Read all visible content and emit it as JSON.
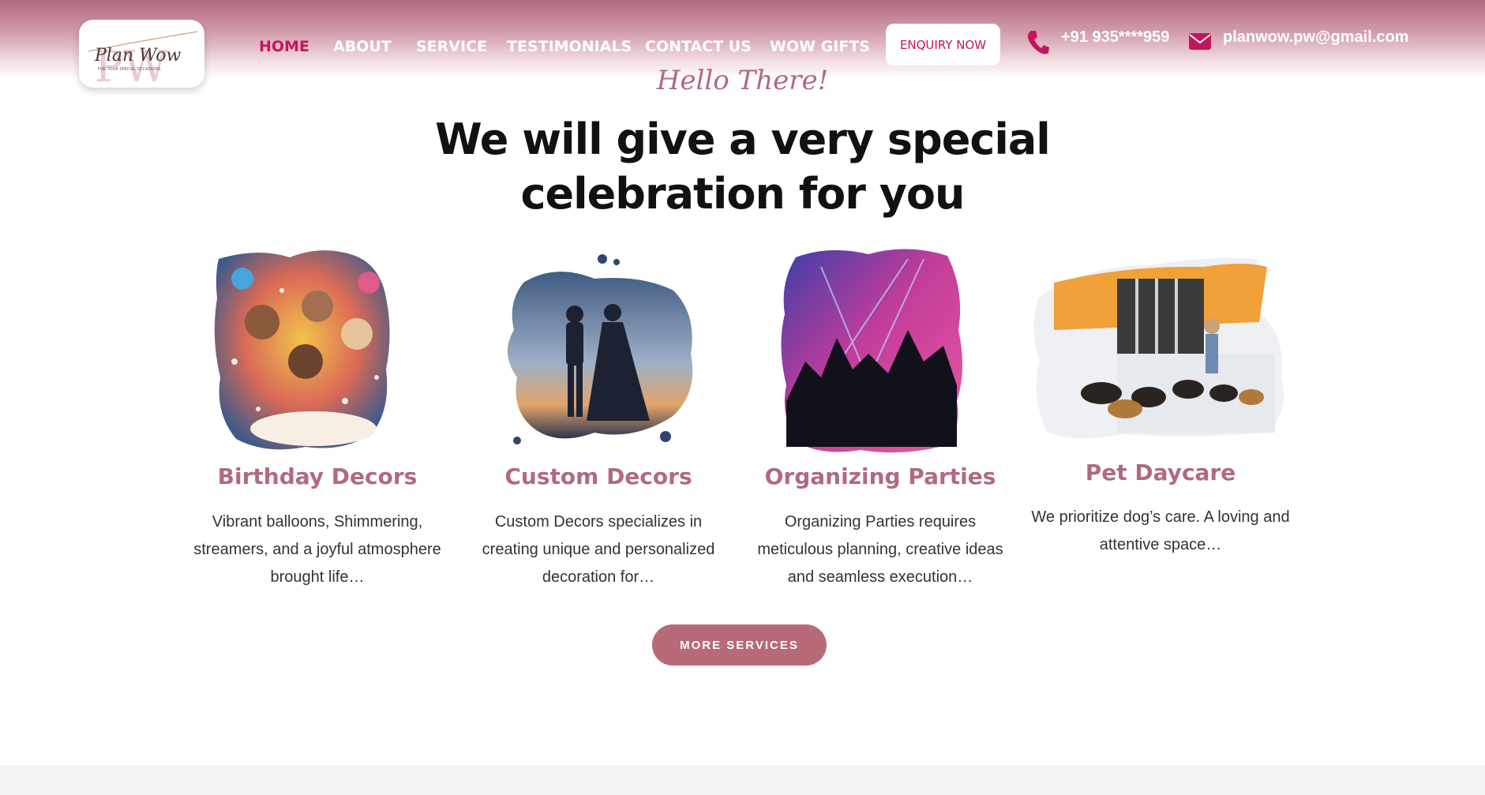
{
  "header": {
    "logo_text": "Plan Wow",
    "logo_monogram": "PW",
    "logo_tagline": "FOR YOUR SPECIAL OCCASIONS",
    "nav": [
      {
        "label": "HOME",
        "active": true
      },
      {
        "label": "ABOUT",
        "active": false
      },
      {
        "label": "SERVICE",
        "active": false
      },
      {
        "label": "TESTIMONIALS",
        "active": false
      },
      {
        "label": "CONTACT US",
        "active": false
      },
      {
        "label": "WOW GIFTS",
        "active": false
      }
    ],
    "enquiry_label": "ENQUIRY NOW",
    "phone": "+91 935****959",
    "email": "planwow.pw@gmail.com"
  },
  "hero": {
    "greeting": "Hello There!",
    "headline_line1": "We will give a very special",
    "headline_line2": "celebration for you"
  },
  "services": [
    {
      "title": "Birthday Decors",
      "desc_line1": "Vibrant balloons, Shimmering,",
      "desc_line2": "streamers, and a joyful atmosphere",
      "desc_line3": "brought life…",
      "image": "party-crowd-photo"
    },
    {
      "title": "Custom Decors",
      "desc_line1": "Custom Decors specializes in",
      "desc_line2": "creating unique and personalized",
      "desc_line3": "decoration for…",
      "image": "wedding-couple-silhouette"
    },
    {
      "title": "Organizing Parties",
      "desc_line1": "Organizing Parties requires",
      "desc_line2": "meticulous planning, creative ideas",
      "desc_line3": "and seamless execution…",
      "image": "concert-crowd-photo"
    },
    {
      "title": "Pet Daycare",
      "desc_line1": "We prioritize dog’s care. A loving and",
      "desc_line2": "attentive space…",
      "desc_line3": "",
      "image": "dogs-daycare-photo"
    }
  ],
  "cta": {
    "more_services_label": "MORE SERVICES"
  },
  "colors": {
    "accent": "#c4155e",
    "brand": "#b06a7e",
    "button": "#b86a78"
  }
}
